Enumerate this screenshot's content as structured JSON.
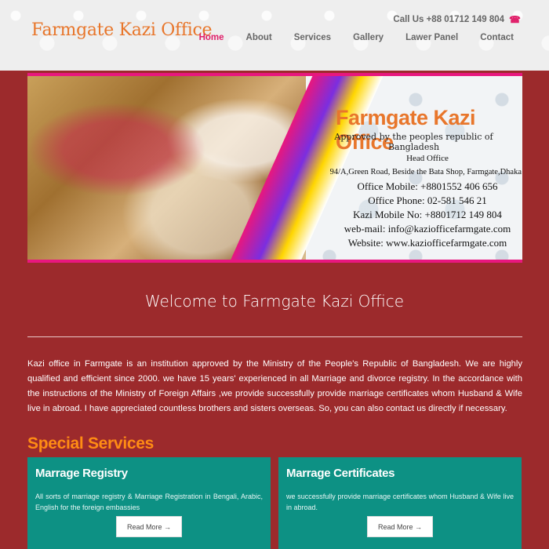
{
  "header": {
    "logo": "Farmgate Kazi Office",
    "call": "Call Us +88 01712 149 804",
    "nav": [
      "Home",
      "About",
      "Services",
      "Gallery",
      "Lawer Panel",
      "Contact"
    ]
  },
  "banner": {
    "title": "Farmgate Kazi Office",
    "subtitle": "Approved by the peoples republic of Bangladesh",
    "lines": [
      "Head Office",
      "94/A,Green Road, Beside the Bata Shop, Farmgate,Dhaka",
      "Office Mobile: +8801552 406 656",
      "Office Phone: 02-581 546 21",
      "Kazi Mobile No: +8801712 149 804",
      "web-mail: info@kaziofficefarmgate.com",
      "Website: www.kaziofficefarmgate.com"
    ]
  },
  "welcome": {
    "title": "Welcome to Farmgate Kazi Office",
    "text": "Kazi office in Farmgate is an institution approved by the Ministry of the People's Republic of Bangladesh. We are highly qualified and efficient since 2000. we have 15 years' experienced in all Marriage and divorce registry. In the accordance with the instructions of the Ministry of Foreign Affairs ,we provide successfully provide marriage certificates whom Husband & Wife live in abroad. I have appreciated countless brothers and sisters overseas. So, you can also contact us directly if necessary."
  },
  "services": {
    "heading": "Special Services",
    "cards": [
      {
        "title": "Marrage Registry",
        "text": "All sorts of marriage registry & Marriage Registration in Bengali, Arabic, English for the foreign embassies",
        "button": "Read More →"
      },
      {
        "title": "Marrage Certificates",
        "text": "we successfully provide marriage certificates whom Husband & Wife live in abroad.",
        "button": "Read More →"
      }
    ]
  },
  "colors": {
    "background": "#9c2a2c",
    "accent": "#e8762b",
    "nav_active": "#e0206a",
    "card": "#0d9184"
  }
}
